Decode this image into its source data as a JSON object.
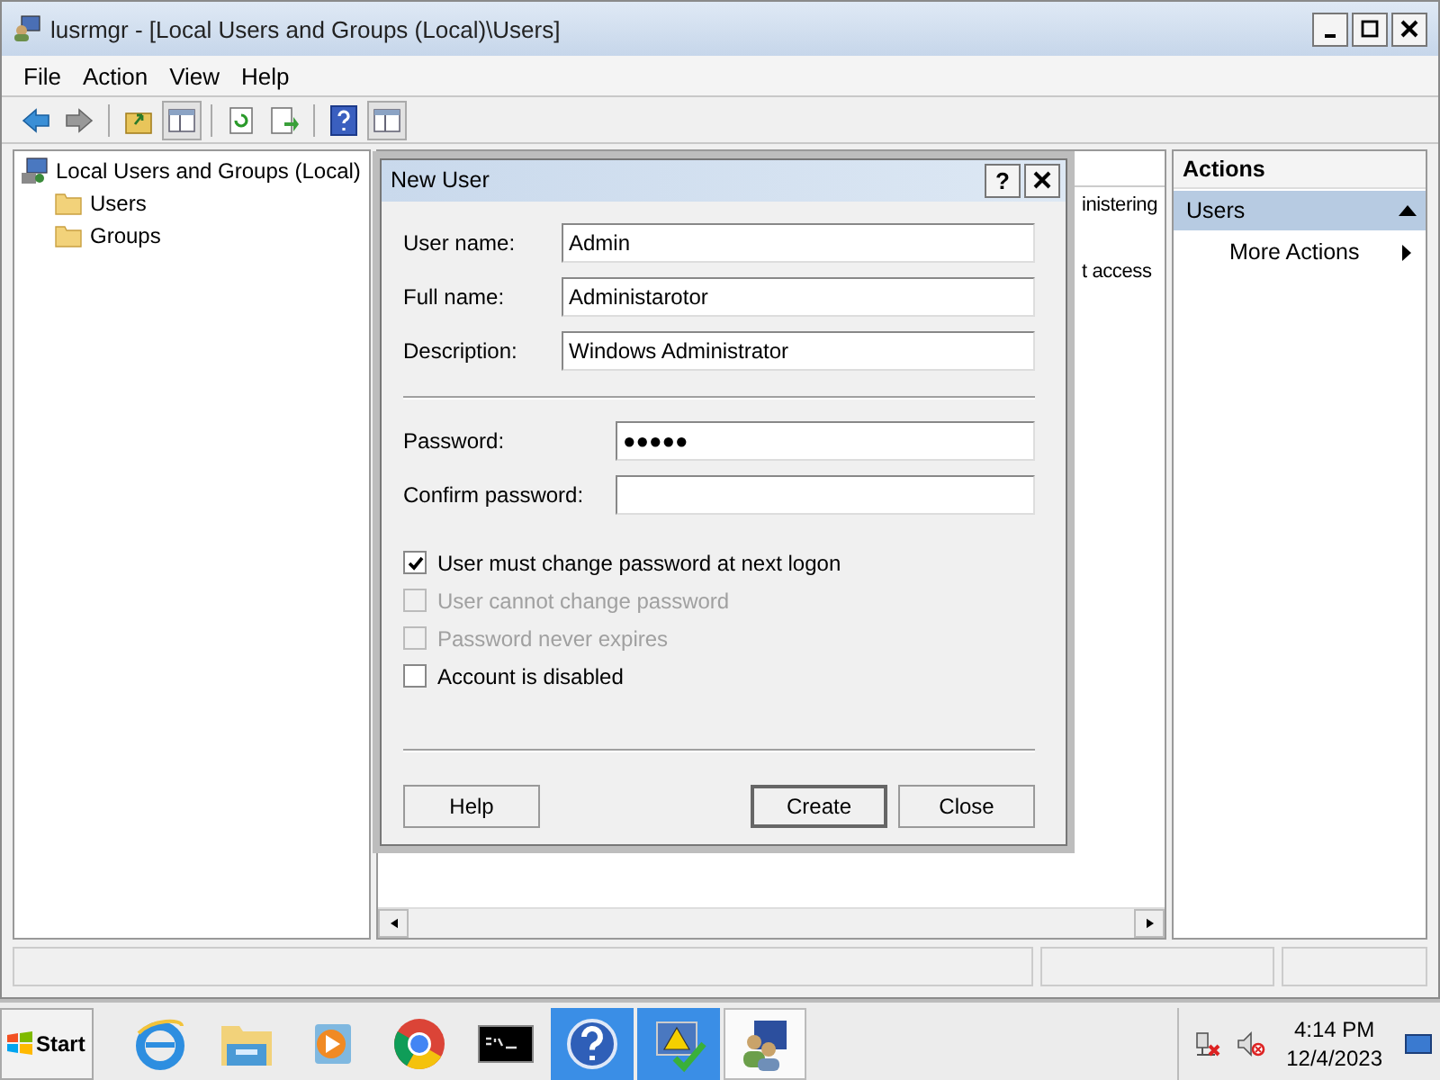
{
  "window": {
    "title": "lusrmgr - [Local Users and Groups (Local)\\Users]"
  },
  "menu": [
    "File",
    "Action",
    "View",
    "Help"
  ],
  "tree": {
    "label": "Local Users and Groups (Local)",
    "children": [
      {
        "label": "Users"
      },
      {
        "label": "Groups"
      }
    ]
  },
  "middle_pane": {
    "row_fragments": [
      "inistering",
      "t access"
    ]
  },
  "actions": {
    "title": "Actions",
    "section": {
      "label": "Users",
      "expanded": true
    },
    "items": [
      "More Actions"
    ]
  },
  "dialog": {
    "title": "New User",
    "help_button": "?",
    "fields": [
      {
        "label": "User name:",
        "value": "Admin",
        "kind": "text"
      },
      {
        "label": "Full name:",
        "value": "Administarotor",
        "kind": "text"
      },
      {
        "label": "Description:",
        "value": "Windows Administrator",
        "kind": "text"
      },
      {
        "label": "Password:",
        "value": "●●●●●",
        "kind": "password"
      },
      {
        "label": "Confirm password:",
        "kind": "password"
      }
    ],
    "checkboxes": [
      {
        "label": "User must change password at next logon",
        "checked": true,
        "disabled": false
      },
      {
        "label": "User cannot change password",
        "checked": false,
        "disabled": true
      },
      {
        "label": "Password never expires",
        "checked": false,
        "disabled": true
      },
      {
        "label": "Account is disabled",
        "checked": false,
        "disabled": false
      }
    ],
    "buttons": [
      {
        "label": "Help",
        "default": false
      },
      {
        "label": "Create",
        "default": true
      },
      {
        "label": "Close",
        "default": false
      }
    ]
  },
  "taskbar": {
    "start": "Start",
    "apps": [
      {
        "kind": "ie",
        "highlighted": false,
        "selected": false
      },
      {
        "kind": "explorer",
        "highlighted": false,
        "selected": false
      },
      {
        "kind": "media",
        "highlighted": false,
        "selected": false
      },
      {
        "kind": "chrome",
        "highlighted": false,
        "selected": false
      },
      {
        "kind": "cmd",
        "highlighted": false,
        "selected": false
      },
      {
        "kind": "help",
        "highlighted": true,
        "selected": false
      },
      {
        "kind": "admin",
        "highlighted": true,
        "selected": false
      },
      {
        "kind": "users",
        "highlighted": false,
        "selected": true
      }
    ],
    "time": "4:14 PM",
    "date": "12/4/2023"
  }
}
